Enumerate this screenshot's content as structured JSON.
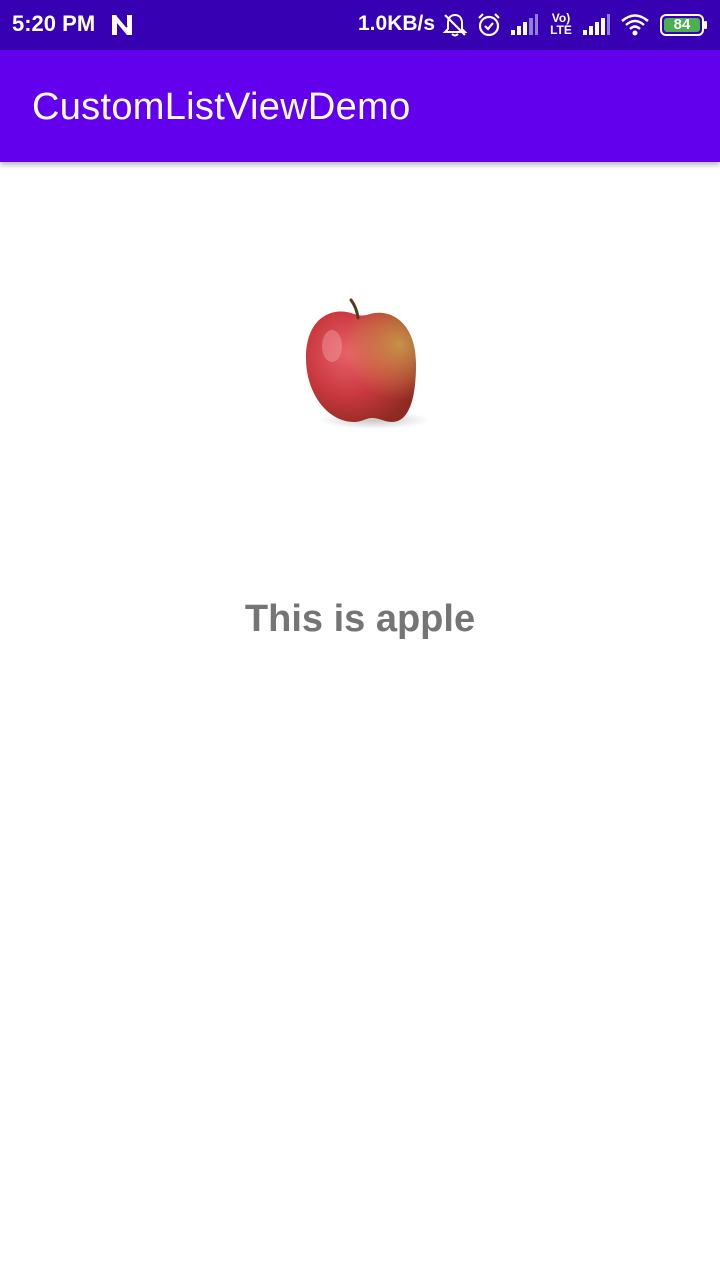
{
  "status_bar": {
    "time": "5:20 PM",
    "network_speed": "1.0KB/s",
    "volte_label": "Vo)",
    "lte_label": "LTE",
    "battery_level": "84",
    "icons": [
      "n-notification-icon",
      "mute-bell-icon",
      "alarm-icon",
      "signal-icon",
      "volte-icon",
      "signal-icon",
      "wifi-icon",
      "battery-icon"
    ],
    "battery_color": "#4caf50"
  },
  "app_bar": {
    "title": "CustomListViewDemo",
    "color": "#6200ee",
    "status_color": "#3700b3"
  },
  "detail": {
    "image_icon": "apple-image",
    "caption": "This is apple",
    "caption_color": "#757575"
  }
}
